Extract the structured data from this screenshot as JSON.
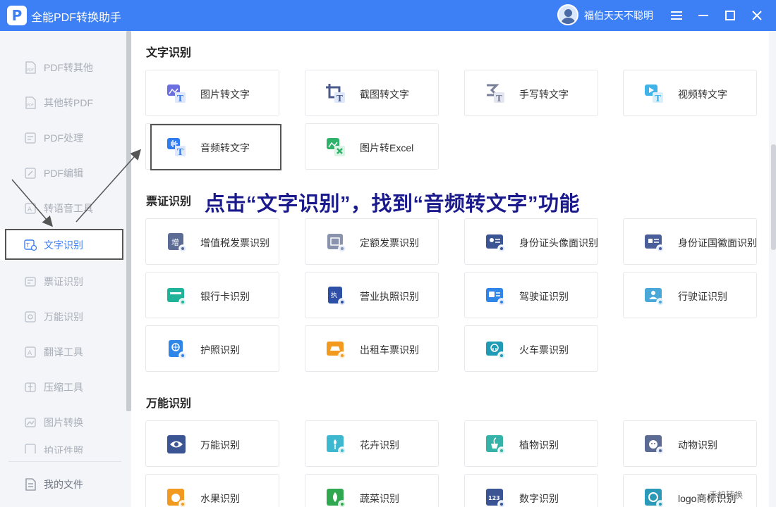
{
  "app": {
    "title": "全能PDF转换助手",
    "logo_glyph": "P",
    "user_name": "福伯天天不聪明"
  },
  "window_controls": {
    "menu": "menu-icon",
    "minimize": "minimize-icon",
    "maximize": "maximize-icon",
    "close": "close-icon"
  },
  "sidebar": {
    "items": [
      {
        "label": "PDF转其他",
        "icon": "pdf-file-icon"
      },
      {
        "label": "其他转PDF",
        "icon": "pdf-file-icon"
      },
      {
        "label": "PDF处理",
        "icon": "pdf-process-icon"
      },
      {
        "label": "PDF编辑",
        "icon": "pdf-edit-icon"
      },
      {
        "label": "转语音工具",
        "icon": "voice-icon"
      },
      {
        "label": "文字识别",
        "icon": "text-ocr-icon",
        "active": true
      },
      {
        "label": "票证识别",
        "icon": "ticket-icon"
      },
      {
        "label": "万能识别",
        "icon": "universal-icon"
      },
      {
        "label": "翻译工具",
        "icon": "translate-icon"
      },
      {
        "label": "压缩工具",
        "icon": "compress-icon"
      },
      {
        "label": "图片转换",
        "icon": "image-convert-icon"
      },
      {
        "label": "拍证件照",
        "icon": "id-photo-icon"
      }
    ],
    "my_files": "我的文件"
  },
  "sections": {
    "text_ocr": {
      "title": "文字识别",
      "cards": [
        "图片转文字",
        "截图转文字",
        "手写转文字",
        "视频转文字",
        "音频转文字",
        "图片转Excel"
      ]
    },
    "ticket_ocr": {
      "title": "票证识别",
      "cards": [
        "增值税发票识别",
        "定额发票识别",
        "身份证头像面识别",
        "身份证国徽面识别",
        "银行卡识别",
        "营业执照识别",
        "驾驶证识别",
        "行驶证识别",
        "护照识别",
        "出租车票识别",
        "火车票识别"
      ]
    },
    "universal_ocr": {
      "title": "万能识别",
      "cards": [
        "万能识别",
        "花卉识别",
        "植物识别",
        "动物识别",
        "水果识别",
        "蔬菜识别",
        "数字识别",
        "logo商标识别"
      ]
    }
  },
  "annotation": "点击“文字识别”，找到“音频转文字”功能",
  "watermark": "手机转换",
  "colors": {
    "accent": "#3d7ff4",
    "annotation": "#1a1a8c"
  }
}
